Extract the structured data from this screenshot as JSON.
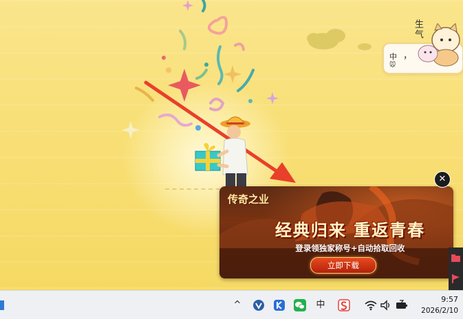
{
  "ime_widget": {
    "lang": "中",
    "punct": "，",
    "mouse": "🐭",
    "word": "生气"
  },
  "ad": {
    "logo_text": "传奇之业",
    "headline": "经典归来  重返青春",
    "subtitle": "登录领独家称号+自动拾取回收",
    "download_label": "立即下载",
    "close_label": "✕"
  },
  "taskbar": {
    "chevron": "^",
    "ime_lang": "中",
    "clock_time": "9:57",
    "clock_date": "2026/2/10"
  },
  "colors": {
    "wallpaper": "#f8df76",
    "arrow": "#e8402a",
    "taskbar": "#eef0f4"
  }
}
